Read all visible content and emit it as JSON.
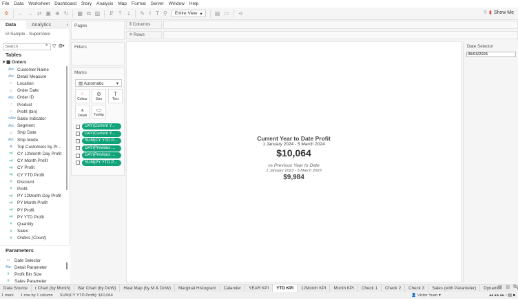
{
  "menu": [
    "File",
    "Data",
    "Worksheet",
    "Dashboard",
    "Story",
    "Analysis",
    "Map",
    "Format",
    "Server",
    "Window",
    "Help"
  ],
  "toolbar": {
    "fit": "Entire View",
    "show_me": "Show Me"
  },
  "datapane": {
    "tab_data": "Data",
    "tab_analytics": "Analytics",
    "source": "Sample - Superstore",
    "search_placeholder": "Search",
    "tables_header": "Tables",
    "table": "Orders",
    "fields": [
      {
        "icon": "Abc",
        "name": "Customer Name",
        "m": false
      },
      {
        "icon": "Abc",
        "name": "Detail Measure",
        "m": false
      },
      {
        "icon": "⛬",
        "name": "Location",
        "m": false
      },
      {
        "icon": "▭",
        "name": "Order Date",
        "m": false
      },
      {
        "icon": "Abc",
        "name": "Order ID",
        "m": false
      },
      {
        "icon": "⛬",
        "name": "Product",
        "m": false
      },
      {
        "icon": "⊥",
        "name": "Profit (bin)",
        "m": false
      },
      {
        "icon": "=Abc",
        "name": "Sales Indicator",
        "m": false
      },
      {
        "icon": "Abc",
        "name": "Segment",
        "m": false
      },
      {
        "icon": "▭",
        "name": "Ship Date",
        "m": false
      },
      {
        "icon": "Abc",
        "name": "Ship Mode",
        "m": false
      },
      {
        "icon": "⊗",
        "name": "Top Customers by Pr...",
        "m": false
      },
      {
        "icon": "=#",
        "name": "CY 12Month Day Profit",
        "m": true
      },
      {
        "icon": "=#",
        "name": "CY Month Profit",
        "m": true
      },
      {
        "icon": "=#",
        "name": "CY Profit",
        "m": true
      },
      {
        "icon": "=#",
        "name": "CY YTD Profit",
        "m": true
      },
      {
        "icon": "#",
        "name": "Discount",
        "m": true
      },
      {
        "icon": "#",
        "name": "Profit",
        "m": true
      },
      {
        "icon": "=#",
        "name": "PY 12Month Day Profit",
        "m": true
      },
      {
        "icon": "=#",
        "name": "PY Month Profit",
        "m": true
      },
      {
        "icon": "=#",
        "name": "PY Profit",
        "m": true
      },
      {
        "icon": "=#",
        "name": "PY YTD Profit",
        "m": true
      },
      {
        "icon": "#",
        "name": "Quantity",
        "m": true
      },
      {
        "icon": "#",
        "name": "Sales",
        "m": true
      },
      {
        "icon": "#",
        "name": "Orders (Count)",
        "m": true
      }
    ],
    "parameters_header": "Parameters",
    "parameters": [
      {
        "icon": "▭",
        "name": "Date Selector"
      },
      {
        "icon": "Abc",
        "name": "Detail Parameter"
      },
      {
        "icon": "#",
        "name": "Profit Bin Size"
      },
      {
        "icon": "#",
        "name": "Sales Parameter"
      }
    ]
  },
  "shelves": {
    "pages": "Pages",
    "filters": "Filters",
    "marks": "Marks",
    "columns": "Columns",
    "rows": "Rows"
  },
  "marks": {
    "type": "Automatic",
    "buttons": [
      "Colour",
      "Size",
      "Text",
      "Detail",
      "Tooltip"
    ],
    "pills": [
      "DAY(Current Y...",
      "DAY(Current Y...",
      "SUM(CY YTD P...",
      "DAY(Previous ...",
      "DAY(Previous ...",
      "SUM(PY YTD P..."
    ]
  },
  "kpi": {
    "title": "Current Year to Date Profit",
    "range": "1 January 2024 - 5 March 2024",
    "value": "$10,064",
    "vs_label": "vs Previous Year to Date",
    "vs_range": "1 January 2023 - 5 March 2023",
    "vs_value": "$9,984"
  },
  "parameter_card": {
    "title": "Date Selector",
    "value": "05/03/2024"
  },
  "sheet_tabs": [
    "Data Source",
    "r Chart (by Month)",
    "Bar Chart (by DoW)",
    "Heat Map (by M & DoW)",
    "Marginal Histogram",
    "Calander",
    "YEAR KPI",
    "YTD KPI",
    "12Month KPI",
    "Month KPI",
    "Check 1",
    "Check 2",
    "Check 3",
    "Sales (with Parameter)",
    "Dynamic Parameters"
  ],
  "active_tab": "YTD KPI",
  "status": {
    "marks": "1 mark",
    "dims": "1 row by 1 column",
    "sum": "SUM(CY YTD Profit): $10,064",
    "user": "Victor Yuan"
  },
  "colors": {
    "pill": "#10a37a"
  }
}
